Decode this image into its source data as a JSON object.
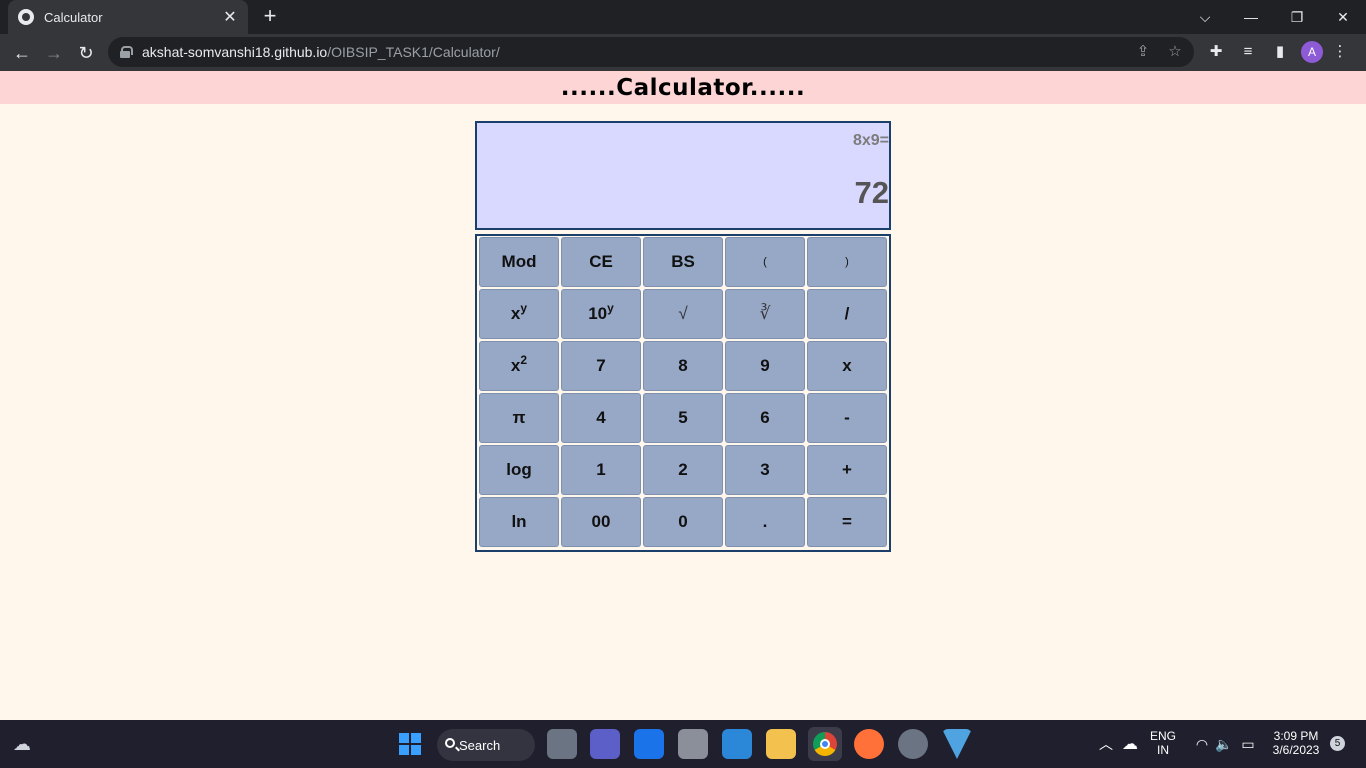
{
  "browser": {
    "tab_title": "Calculator",
    "tab_close": "✕",
    "new_tab": "+",
    "url_host": "akshat-somvanshi18.github.io",
    "url_path": "/OIBSIP_TASK1/Calculator/",
    "profile_initial": "A",
    "window_controls": {
      "tab_search": "⌵",
      "minimize": "—",
      "restore": "❐",
      "close": "✕"
    },
    "nav": {
      "back": "←",
      "forward": "→",
      "reload": "↻"
    }
  },
  "page": {
    "header_title": "......Calculator......"
  },
  "calculator": {
    "expression": "8x9=",
    "result": "72",
    "keys": {
      "mod": "Mod",
      "ce": "CE",
      "bs": "BS",
      "open_paren": "(",
      "close_paren": ")",
      "pow_base": "x",
      "pow_sup": "y",
      "ten_base": "10",
      "ten_sup": "y",
      "sqrt": "√",
      "cbrt": "∛",
      "divide": "/",
      "sq_base": "x",
      "sq_sup": "2",
      "seven": "7",
      "eight": "8",
      "nine": "9",
      "multiply": "x",
      "pi": "π",
      "four": "4",
      "five": "5",
      "six": "6",
      "minus": "-",
      "log": "log",
      "one": "1",
      "two": "2",
      "three": "3",
      "plus": "+",
      "ln": "ln",
      "double_zero": "00",
      "zero": "0",
      "decimal": ".",
      "equals": "="
    }
  },
  "taskbar": {
    "search_label": "Search",
    "language": "ENG",
    "region": "IN",
    "time": "3:09 PM",
    "date": "3/6/2023",
    "notification_count": "5"
  }
}
